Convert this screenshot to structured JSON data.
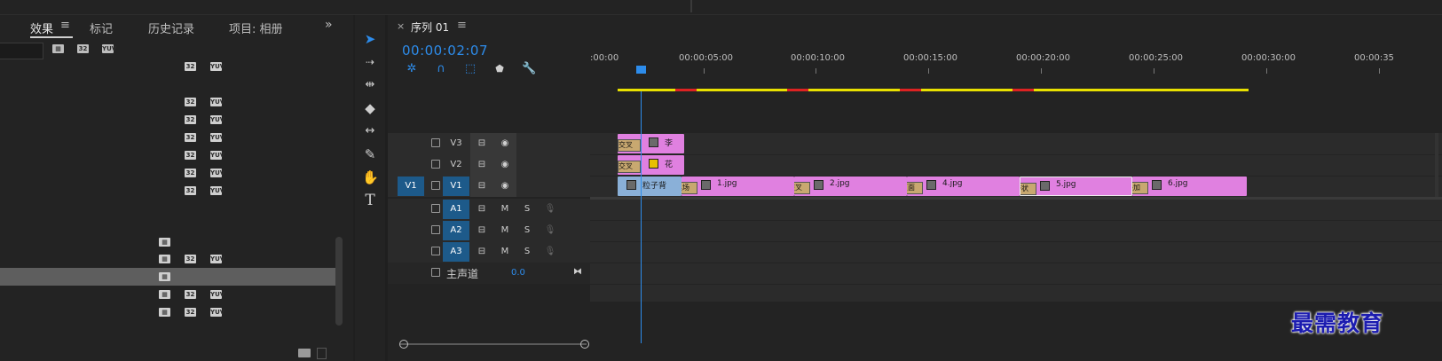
{
  "tabs": {
    "effects": "效果",
    "markers": "标记",
    "history": "历史记录",
    "project": "项目: 相册"
  },
  "effects_toolbar": [
    "32",
    "YUV"
  ],
  "sequence": {
    "title": "序列 01",
    "timecode": "00:00:02:07"
  },
  "ruler": [
    ":00:00",
    "00:00:05:00",
    "00:00:10:00",
    "00:00:15:00",
    "00:00:20:00",
    "00:00:25:00",
    "00:00:30:00",
    "00:00:35"
  ],
  "tracks": {
    "video": [
      {
        "name": "V3"
      },
      {
        "name": "V2"
      },
      {
        "name": "V1",
        "source": "V1"
      }
    ],
    "audio": [
      {
        "name": "A1",
        "m": "M",
        "s": "S"
      },
      {
        "name": "A2",
        "m": "M",
        "s": "S"
      },
      {
        "name": "A3",
        "m": "M",
        "s": "S"
      }
    ],
    "master_label": "主声道",
    "master_value": "0.0"
  },
  "clips": {
    "v3": {
      "transition": "交叉",
      "name": "李"
    },
    "v2": {
      "transition": "交叉",
      "name": "花"
    },
    "v1": [
      {
        "name": "粒子背"
      },
      {
        "name": "1.jpg",
        "transition": "黑场"
      },
      {
        "name": "2.jpg",
        "transition": "交叉"
      },
      {
        "name": "4.jpg",
        "transition": "页面"
      },
      {
        "name": "5.jpg",
        "transition": "带状"
      },
      {
        "name": "6.jpg",
        "transition": "叠加"
      }
    ]
  },
  "watermark": "最需教育"
}
